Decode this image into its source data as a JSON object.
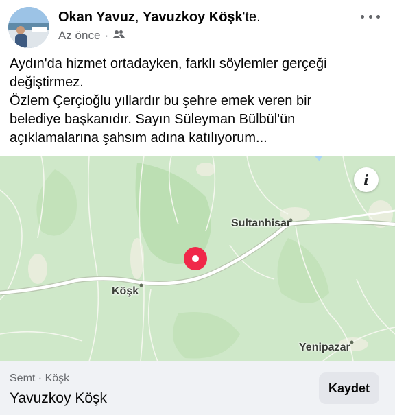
{
  "post": {
    "author_name": "Okan Yavuz",
    "author_connector": ", ",
    "location_name": "Yavuzkoy Köşk",
    "location_suffix": "'te.",
    "time": "Az önce",
    "separator": "·",
    "audience_icon": "friends-icon",
    "more_icon": "more-options-icon",
    "text_lines": [
      "Aydın'da hizmet ortadayken, farklı söylemler gerçeği",
      "değiştirmez.",
      "Özlem Çerçioğlu yıllardır bu şehre emek veren bir",
      "belediye başkanıdır. Sayın Süleyman Bülbül'ün",
      "açıklamalarına şahsım adına katılıyorum..."
    ]
  },
  "map": {
    "info_button": "i",
    "labels": {
      "sultanhisar": "Sultanhisar",
      "kosk": "Köşk",
      "yenipazar": "Yenipazar"
    },
    "pin_color": "#f02849",
    "land_color": "#cfe8c9",
    "road_color": "#ffffff"
  },
  "place": {
    "category": "Semt · Köşk",
    "name": "Yavuzkoy Köşk",
    "save_label": "Kaydet"
  }
}
